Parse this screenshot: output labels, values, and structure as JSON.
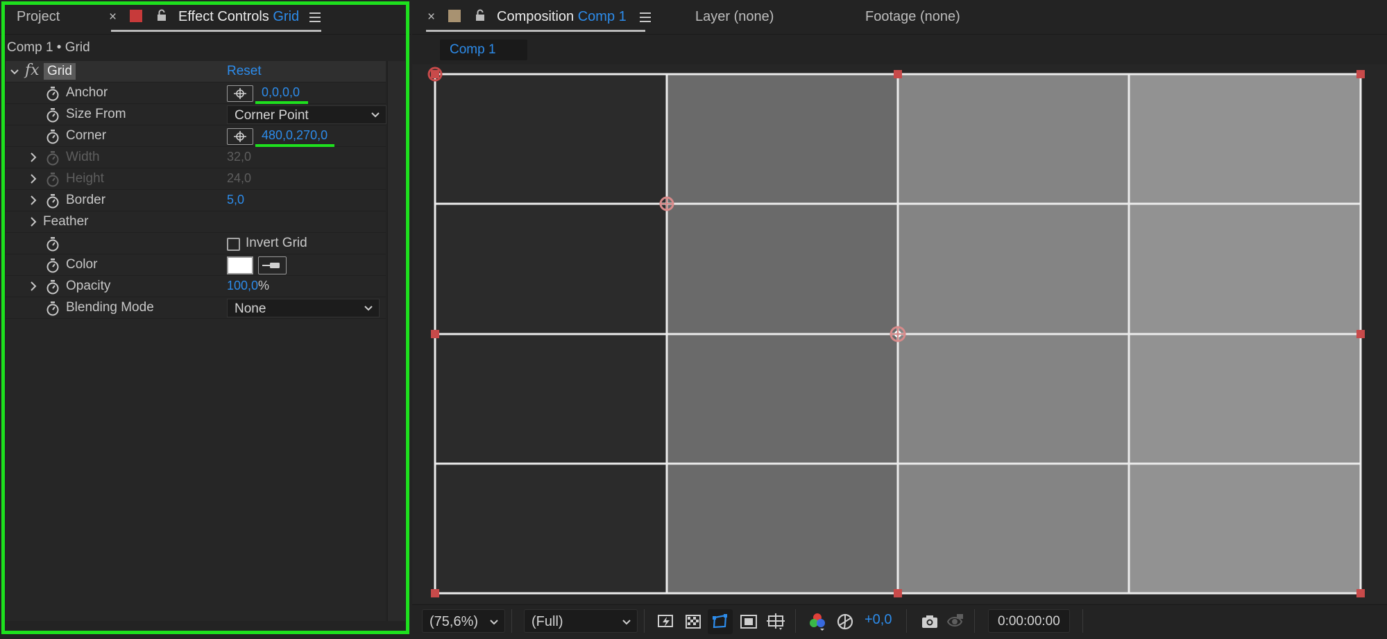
{
  "left_panel": {
    "tabs": {
      "project": "Project",
      "effect_controls_label": "Effect Controls",
      "effect_controls_layer": "Grid"
    },
    "comp_path": "Comp 1 • Grid",
    "effect": {
      "fx_symbol": "fx",
      "name": "Grid",
      "reset_label": "Reset"
    },
    "properties": {
      "anchor": {
        "label": "Anchor",
        "value": "0,0,0,0"
      },
      "size_from": {
        "label": "Size From",
        "value": "Corner Point"
      },
      "corner": {
        "label": "Corner",
        "value": "480,0,270,0"
      },
      "width": {
        "label": "Width",
        "value": "32,0"
      },
      "height": {
        "label": "Height",
        "value": "24,0"
      },
      "border": {
        "label": "Border",
        "value": "5,0"
      },
      "feather": {
        "label": "Feather"
      },
      "invert_grid": {
        "label": "Invert Grid",
        "checked": false
      },
      "color": {
        "label": "Color",
        "value_hex": "#ffffff"
      },
      "opacity": {
        "label": "Opacity",
        "value": "100,0",
        "unit": "%"
      },
      "blending_mode": {
        "label": "Blending Mode",
        "value": "None"
      }
    }
  },
  "right_panel": {
    "tabs": {
      "composition_label": "Composition",
      "composition_name": "Comp 1",
      "layer": "Layer (none)",
      "footage": "Footage (none)"
    },
    "sub_tab": "Comp 1",
    "toolbar": {
      "zoom": "(75,6%)",
      "resolution": "(Full)",
      "exposure": "+0,0",
      "timecode": "0:00:00:00"
    }
  },
  "colors": {
    "accent_blue": "#2d8ceb",
    "highlight_green": "#1ee01e",
    "layer_label_red": "#c73a3a",
    "comp_label_tan": "#a89271",
    "handle_red": "#c84a4a"
  },
  "icons": {
    "lock": "lock-icon",
    "panel_menu": "hamburger-menu-icon",
    "stopwatch": "stopwatch-icon",
    "target": "crosshair-target-icon",
    "eyedropper": "eyedropper-icon",
    "snapshot": "camera-icon",
    "show_snapshot": "show-snapshot-icon"
  }
}
